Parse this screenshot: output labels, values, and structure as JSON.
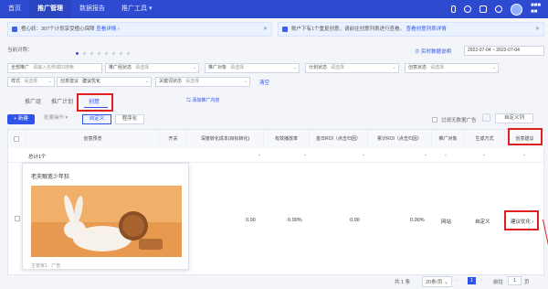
{
  "nav": {
    "items": [
      "首页",
      "推广管理",
      "数据报告",
      "推广工具"
    ],
    "active": "推广管理",
    "tools_arrow": "▾"
  },
  "account": {
    "line1": "■■■",
    "line2": "■■"
  },
  "notices": [
    {
      "text": "橙心妖：307个计划享受橙心保障",
      "link": "查看详情 ›"
    },
    {
      "text": "账户下有1个重复创意，请前往创意列表进行查看。",
      "link": "查看创意列表详情"
    }
  ],
  "summary": {
    "label": "当前对照："
  },
  "date": {
    "help": "⓪ 实时数据说明",
    "range": "2022-07-04 ~ 2022-07-04"
  },
  "filters": {
    "row1": [
      {
        "label": "全部推广",
        "value": "请输入名称或ID搜索"
      },
      {
        "label": "推广组状态",
        "value": "请选择"
      },
      {
        "label": "推广对象",
        "value": "请选择"
      },
      {
        "label": "计划状态",
        "value": "请选择"
      },
      {
        "label": "创意状态",
        "value": "请选择"
      }
    ],
    "row2": [
      {
        "label": "样式",
        "value": "请选择"
      },
      {
        "label": "创意建议",
        "value": "建议优化"
      },
      {
        "label": "关键词状态",
        "value": "请选择"
      }
    ],
    "reset": "清空"
  },
  "tabs": {
    "items": [
      "推广组",
      "推广计划",
      "创意"
    ],
    "active": "创意",
    "extra": "⇆ 添加推广内容"
  },
  "toolbar": {
    "new": "+ 新建",
    "batch": "批量操作 ▾",
    "custom": "自定义",
    "programmatic": "程序化",
    "filter_no_data": "过滤无数据广告",
    "column_config": "自定义列"
  },
  "table": {
    "columns": [
      "创意预览",
      "开关",
      "深度转化成本(目标转化)",
      "有效播放率",
      "首日ROI（点击归因）",
      "累计ROI（点击归因）",
      "推广对象",
      "生成方式",
      "创意建议"
    ],
    "total_row": {
      "label": "总计1个",
      "values": [
        "-",
        "-",
        "-",
        "-",
        "-",
        "-",
        "-"
      ]
    },
    "row": {
      "creative_title": "老夫眼宽少年狂",
      "creative_meta": "主管家1 · 广告",
      "cost": "0.00",
      "play_rate": "0.00%",
      "first_roi": "0.00",
      "total_roi": "0.00%",
      "target": "网站",
      "mode": "自定义",
      "suggestion": "建议优化 ›"
    }
  },
  "pager": {
    "total": "共 1 条",
    "page_size": "20条/页",
    "page": "1",
    "goto_label": "前往",
    "goto_value": "1",
    "page_unit": "页"
  },
  "colors": {
    "nav": "#2d4ad1",
    "accent": "#2f54eb",
    "highlight": "#e02020"
  }
}
